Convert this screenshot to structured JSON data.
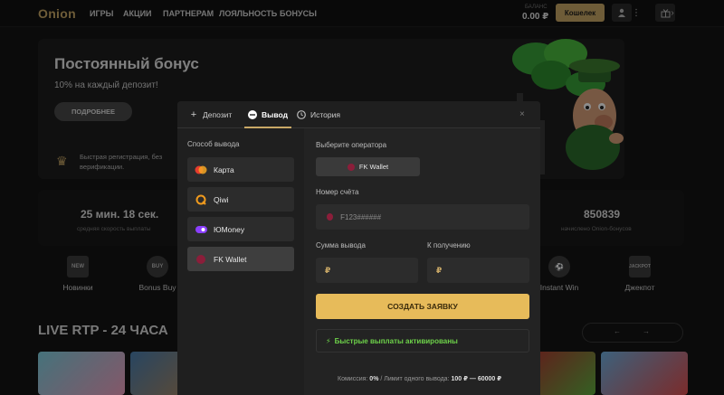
{
  "header": {
    "logo": "Onion",
    "nav": [
      "ИГРЫ",
      "АКЦИИ",
      "ПАРТНЕРАМ",
      "ЛОЯЛЬНОСТЬ",
      "БОНУСЫ"
    ],
    "balance_label": "БАЛАНС",
    "balance_value": "0.00 ₽",
    "wallet_button": "Кошелек",
    "icons": [
      "user-icon",
      "more-icon",
      "gift-icon",
      "chevron-right-icon"
    ]
  },
  "banner": {
    "title": "Постоянный бонус",
    "subtitle": "10% на каждый депозит!",
    "button": "ПОДРОБНЕЕ",
    "registration_text": "Быстрая регистрация, без верификации."
  },
  "stats": [
    {
      "value": "25 мин. 18 сек.",
      "label": "средняя скорость выплаты"
    },
    {
      "value": "850839",
      "label": "начислено Onion-бонусов"
    }
  ],
  "categories": [
    {
      "label": "Новинки",
      "badge": "NEW"
    },
    {
      "label": "Bonus Buy",
      "badge": "BUY"
    },
    {
      "label": "Instant Win",
      "badge": "⚽"
    },
    {
      "label": "Джекпот",
      "badge": "JACKPOT"
    }
  ],
  "live_title": "LIVE RTP - 24 ЧАСА",
  "pager": {
    "prev": "←",
    "next": "→"
  },
  "modal": {
    "tabs": [
      {
        "label": "Депозит",
        "icon": "plus-icon"
      },
      {
        "label": "Вывод",
        "icon": "minus-icon",
        "active": true
      },
      {
        "label": "История",
        "icon": "clock-icon"
      }
    ],
    "close": "×",
    "methods_title": "Способ вывода",
    "methods": [
      {
        "label": "Карта",
        "icon": "card-icon"
      },
      {
        "label": "Qiwi",
        "icon": "qiwi-icon"
      },
      {
        "label": "ЮMoney",
        "icon": "yoomoney-icon"
      },
      {
        "label": "FK Wallet",
        "icon": "fkwallet-icon",
        "selected": true
      }
    ],
    "operator_label": "Выберите оператора",
    "operator_value": "FK Wallet",
    "account_label": "Номер счёта",
    "account_placeholder": "F123######",
    "amount_label": "Сумма вывода",
    "receive_label": "К получению",
    "currency_symbol": "₽",
    "submit": "СОЗДАТЬ ЗАЯВКУ",
    "fast_payouts": "Быстрые выплаты активированы",
    "fee_prefix": "Комиссия:",
    "fee_value": "0%",
    "limit_prefix": "/ Лимит одного вывода:",
    "limit_value": "100 ₽ — 60000 ₽"
  },
  "colors": {
    "accent": "#c9a866",
    "button": "#e7bb5a",
    "success": "#6ed34a",
    "background": "#141414"
  }
}
